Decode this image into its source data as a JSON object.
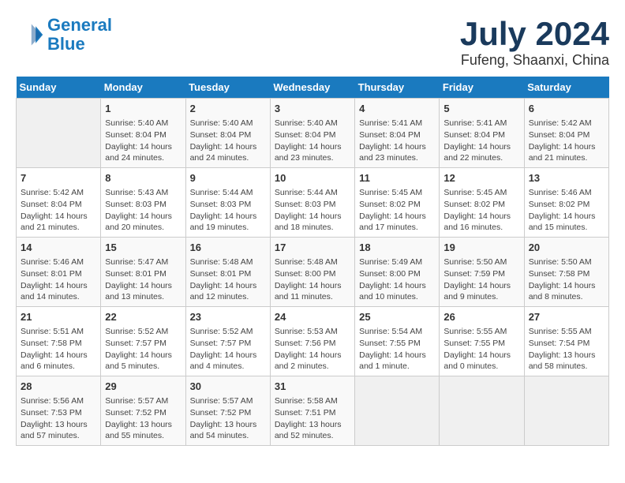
{
  "logo": {
    "line1": "General",
    "line2": "Blue"
  },
  "title": "July 2024",
  "location": "Fufeng, Shaanxi, China",
  "days_of_week": [
    "Sunday",
    "Monday",
    "Tuesday",
    "Wednesday",
    "Thursday",
    "Friday",
    "Saturday"
  ],
  "weeks": [
    [
      {
        "day": "",
        "info": ""
      },
      {
        "day": "1",
        "info": "Sunrise: 5:40 AM\nSunset: 8:04 PM\nDaylight: 14 hours\nand 24 minutes."
      },
      {
        "day": "2",
        "info": "Sunrise: 5:40 AM\nSunset: 8:04 PM\nDaylight: 14 hours\nand 24 minutes."
      },
      {
        "day": "3",
        "info": "Sunrise: 5:40 AM\nSunset: 8:04 PM\nDaylight: 14 hours\nand 23 minutes."
      },
      {
        "day": "4",
        "info": "Sunrise: 5:41 AM\nSunset: 8:04 PM\nDaylight: 14 hours\nand 23 minutes."
      },
      {
        "day": "5",
        "info": "Sunrise: 5:41 AM\nSunset: 8:04 PM\nDaylight: 14 hours\nand 22 minutes."
      },
      {
        "day": "6",
        "info": "Sunrise: 5:42 AM\nSunset: 8:04 PM\nDaylight: 14 hours\nand 21 minutes."
      }
    ],
    [
      {
        "day": "7",
        "info": "Sunrise: 5:42 AM\nSunset: 8:04 PM\nDaylight: 14 hours\nand 21 minutes."
      },
      {
        "day": "8",
        "info": "Sunrise: 5:43 AM\nSunset: 8:03 PM\nDaylight: 14 hours\nand 20 minutes."
      },
      {
        "day": "9",
        "info": "Sunrise: 5:44 AM\nSunset: 8:03 PM\nDaylight: 14 hours\nand 19 minutes."
      },
      {
        "day": "10",
        "info": "Sunrise: 5:44 AM\nSunset: 8:03 PM\nDaylight: 14 hours\nand 18 minutes."
      },
      {
        "day": "11",
        "info": "Sunrise: 5:45 AM\nSunset: 8:02 PM\nDaylight: 14 hours\nand 17 minutes."
      },
      {
        "day": "12",
        "info": "Sunrise: 5:45 AM\nSunset: 8:02 PM\nDaylight: 14 hours\nand 16 minutes."
      },
      {
        "day": "13",
        "info": "Sunrise: 5:46 AM\nSunset: 8:02 PM\nDaylight: 14 hours\nand 15 minutes."
      }
    ],
    [
      {
        "day": "14",
        "info": "Sunrise: 5:46 AM\nSunset: 8:01 PM\nDaylight: 14 hours\nand 14 minutes."
      },
      {
        "day": "15",
        "info": "Sunrise: 5:47 AM\nSunset: 8:01 PM\nDaylight: 14 hours\nand 13 minutes."
      },
      {
        "day": "16",
        "info": "Sunrise: 5:48 AM\nSunset: 8:01 PM\nDaylight: 14 hours\nand 12 minutes."
      },
      {
        "day": "17",
        "info": "Sunrise: 5:48 AM\nSunset: 8:00 PM\nDaylight: 14 hours\nand 11 minutes."
      },
      {
        "day": "18",
        "info": "Sunrise: 5:49 AM\nSunset: 8:00 PM\nDaylight: 14 hours\nand 10 minutes."
      },
      {
        "day": "19",
        "info": "Sunrise: 5:50 AM\nSunset: 7:59 PM\nDaylight: 14 hours\nand 9 minutes."
      },
      {
        "day": "20",
        "info": "Sunrise: 5:50 AM\nSunset: 7:58 PM\nDaylight: 14 hours\nand 8 minutes."
      }
    ],
    [
      {
        "day": "21",
        "info": "Sunrise: 5:51 AM\nSunset: 7:58 PM\nDaylight: 14 hours\nand 6 minutes."
      },
      {
        "day": "22",
        "info": "Sunrise: 5:52 AM\nSunset: 7:57 PM\nDaylight: 14 hours\nand 5 minutes."
      },
      {
        "day": "23",
        "info": "Sunrise: 5:52 AM\nSunset: 7:57 PM\nDaylight: 14 hours\nand 4 minutes."
      },
      {
        "day": "24",
        "info": "Sunrise: 5:53 AM\nSunset: 7:56 PM\nDaylight: 14 hours\nand 2 minutes."
      },
      {
        "day": "25",
        "info": "Sunrise: 5:54 AM\nSunset: 7:55 PM\nDaylight: 14 hours\nand 1 minute."
      },
      {
        "day": "26",
        "info": "Sunrise: 5:55 AM\nSunset: 7:55 PM\nDaylight: 14 hours\nand 0 minutes."
      },
      {
        "day": "27",
        "info": "Sunrise: 5:55 AM\nSunset: 7:54 PM\nDaylight: 13 hours\nand 58 minutes."
      }
    ],
    [
      {
        "day": "28",
        "info": "Sunrise: 5:56 AM\nSunset: 7:53 PM\nDaylight: 13 hours\nand 57 minutes."
      },
      {
        "day": "29",
        "info": "Sunrise: 5:57 AM\nSunset: 7:52 PM\nDaylight: 13 hours\nand 55 minutes."
      },
      {
        "day": "30",
        "info": "Sunrise: 5:57 AM\nSunset: 7:52 PM\nDaylight: 13 hours\nand 54 minutes."
      },
      {
        "day": "31",
        "info": "Sunrise: 5:58 AM\nSunset: 7:51 PM\nDaylight: 13 hours\nand 52 minutes."
      },
      {
        "day": "",
        "info": ""
      },
      {
        "day": "",
        "info": ""
      },
      {
        "day": "",
        "info": ""
      }
    ]
  ]
}
